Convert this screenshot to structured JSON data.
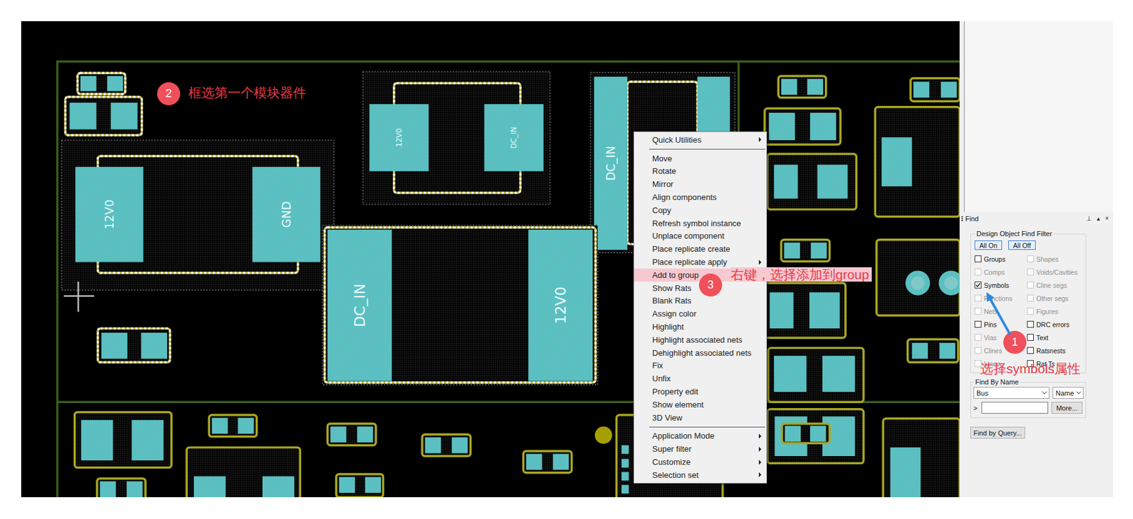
{
  "pcb": {
    "components": [
      {
        "selected": true,
        "labels": []
      },
      {
        "selected": true,
        "labels": []
      },
      {
        "selected": true,
        "labels": [
          "12V0",
          "GND"
        ]
      },
      {
        "selected": true,
        "labels": [
          "12V0",
          "DC_IN"
        ]
      },
      {
        "selected": true,
        "labels": [
          "DC_IN"
        ]
      },
      {
        "selected": true,
        "labels": [
          "DC_IN",
          "12V0"
        ]
      },
      {
        "selected": true,
        "labels": []
      },
      {
        "selected": false,
        "labels": []
      },
      {
        "selected": false,
        "labels": []
      },
      {
        "selected": false,
        "labels": []
      },
      {
        "selected": false,
        "labels": []
      },
      {
        "selected": false,
        "labels": []
      },
      {
        "selected": false,
        "labels": []
      },
      {
        "selected": false,
        "labels": []
      },
      {
        "selected": false,
        "labels": []
      },
      {
        "selected": false,
        "labels": []
      },
      {
        "selected": false,
        "labels": []
      },
      {
        "selected": false,
        "labels": []
      },
      {
        "selected": false,
        "labels": []
      },
      {
        "selected": false,
        "labels": []
      },
      {
        "selected": false,
        "labels": []
      },
      {
        "selected": false,
        "labels": []
      },
      {
        "selected": false,
        "labels": []
      },
      {
        "selected": false,
        "labels": []
      },
      {
        "selected": false,
        "labels": []
      },
      {
        "selected": false,
        "labels": []
      },
      {
        "selected": false,
        "labels": []
      },
      {
        "selected": false,
        "labels": []
      },
      {
        "selected": false,
        "labels": []
      }
    ]
  },
  "context_menu": {
    "items": [
      {
        "kind": "item",
        "label": "Quick Utilities",
        "submenu": true,
        "highlighted": false
      },
      {
        "kind": "separator"
      },
      {
        "kind": "item",
        "label": "Move",
        "submenu": false,
        "highlighted": false
      },
      {
        "kind": "item",
        "label": "Rotate",
        "submenu": false,
        "highlighted": false
      },
      {
        "kind": "item",
        "label": "Mirror",
        "submenu": false,
        "highlighted": false
      },
      {
        "kind": "item",
        "label": "Align components",
        "submenu": false,
        "highlighted": false
      },
      {
        "kind": "item",
        "label": "Copy",
        "submenu": false,
        "highlighted": false
      },
      {
        "kind": "item",
        "label": "Refresh symbol instance",
        "submenu": false,
        "highlighted": false
      },
      {
        "kind": "item",
        "label": "Unplace component",
        "submenu": false,
        "highlighted": false
      },
      {
        "kind": "item",
        "label": "Place replicate create",
        "submenu": false,
        "highlighted": false
      },
      {
        "kind": "item",
        "label": "Place replicate apply",
        "submenu": true,
        "highlighted": false
      },
      {
        "kind": "item",
        "label": "Add to group",
        "submenu": false,
        "highlighted": true
      },
      {
        "kind": "item",
        "label": "Show Rats",
        "submenu": false,
        "highlighted": false
      },
      {
        "kind": "item",
        "label": "Blank Rats",
        "submenu": false,
        "highlighted": false
      },
      {
        "kind": "item",
        "label": "Assign color",
        "submenu": false,
        "highlighted": false
      },
      {
        "kind": "item",
        "label": "Highlight",
        "submenu": false,
        "highlighted": false
      },
      {
        "kind": "item",
        "label": "Highlight associated nets",
        "submenu": false,
        "highlighted": false
      },
      {
        "kind": "item",
        "label": "Dehighlight associated nets",
        "submenu": false,
        "highlighted": false
      },
      {
        "kind": "item",
        "label": "Fix",
        "submenu": false,
        "highlighted": false
      },
      {
        "kind": "item",
        "label": "Unfix",
        "submenu": false,
        "highlighted": false
      },
      {
        "kind": "item",
        "label": "Property edit",
        "submenu": false,
        "highlighted": false
      },
      {
        "kind": "item",
        "label": "Show element",
        "submenu": false,
        "highlighted": false
      },
      {
        "kind": "item",
        "label": "3D View",
        "submenu": false,
        "highlighted": false
      },
      {
        "kind": "separator"
      },
      {
        "kind": "item",
        "label": "Application Mode",
        "submenu": true,
        "highlighted": false
      },
      {
        "kind": "item",
        "label": "Super filter",
        "submenu": true,
        "highlighted": false
      },
      {
        "kind": "item",
        "label": "Customize",
        "submenu": true,
        "highlighted": false
      },
      {
        "kind": "item",
        "label": "Selection set",
        "submenu": true,
        "highlighted": false
      }
    ]
  },
  "annotations": [
    {
      "number": "2",
      "text": "框选第一个模块器件"
    },
    {
      "number": "3",
      "text": "右键，选择添加到group"
    },
    {
      "number": "1",
      "text": "选择symbols属性"
    }
  ],
  "find_panel": {
    "title": "Find",
    "controls": [
      "⊥",
      "▴",
      "×"
    ],
    "filter_title": "Design Object Find Filter",
    "buttons": [
      "All On",
      "All Off"
    ],
    "filters": [
      {
        "label": "Groups",
        "checked": false,
        "disabled": false
      },
      {
        "label": "Shapes",
        "checked": false,
        "disabled": true
      },
      {
        "label": "Comps",
        "checked": false,
        "disabled": true
      },
      {
        "label": "Voids/Cavities",
        "checked": false,
        "disabled": true
      },
      {
        "label": "Symbols",
        "checked": true,
        "disabled": false
      },
      {
        "label": "Cline segs",
        "checked": false,
        "disabled": true
      },
      {
        "label": "Functions",
        "checked": false,
        "disabled": true
      },
      {
        "label": "Other segs",
        "checked": false,
        "disabled": true
      },
      {
        "label": "Nets",
        "checked": false,
        "disabled": true
      },
      {
        "label": "Figures",
        "checked": false,
        "disabled": true
      },
      {
        "label": "Pins",
        "checked": false,
        "disabled": false
      },
      {
        "label": "DRC errors",
        "checked": false,
        "disabled": false
      },
      {
        "label": "Vias",
        "checked": false,
        "disabled": true
      },
      {
        "label": "Text",
        "checked": false,
        "disabled": false
      },
      {
        "label": "Clines",
        "checked": false,
        "disabled": true
      },
      {
        "label": "Ratsnests",
        "checked": false,
        "disabled": false
      },
      {
        "label": "Lines",
        "checked": false,
        "disabled": true
      },
      {
        "label": "Rat Ts",
        "checked": false,
        "disabled": false
      }
    ],
    "find_by_name": {
      "title": "Find By Name",
      "type": "Bus",
      "mode": "Name",
      "prefix": ">",
      "value": "",
      "more": "More..."
    },
    "query_button": "Find by Query..."
  }
}
